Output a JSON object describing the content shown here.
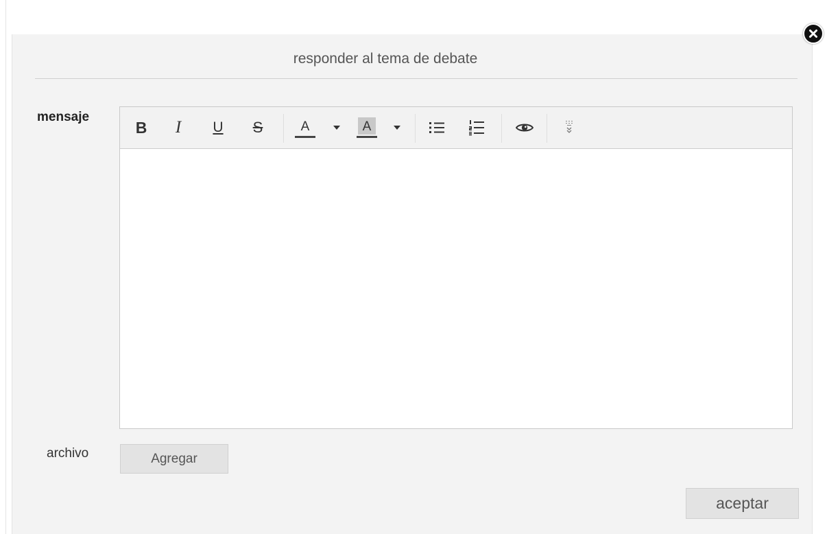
{
  "dialog": {
    "title": "responder al tema de debate",
    "close_icon": "close-circle-icon"
  },
  "form": {
    "message_label": "mensaje",
    "file_label": "archivo",
    "add_button": "Agregar",
    "accept_button": "aceptar"
  },
  "toolbar": {
    "bold": "B",
    "italic": "I",
    "underline": "U",
    "strikethrough": "S",
    "font_color_letter": "A",
    "bg_color_letter": "A",
    "font_color_bar": "#444444",
    "bg_color_fill": "#c8c8c8",
    "icons": [
      "bold-icon",
      "italic-icon",
      "underline-icon",
      "strikethrough-icon",
      "font-color-icon",
      "background-color-icon",
      "bullet-list-icon",
      "numbered-list-icon",
      "preview-eye-icon",
      "more-tools-icon"
    ]
  },
  "editor": {
    "content": ""
  },
  "colors": {
    "dialog_bg": "#f3f3f3",
    "button_bg": "#e3e3e3",
    "close_bg": "#111111"
  }
}
